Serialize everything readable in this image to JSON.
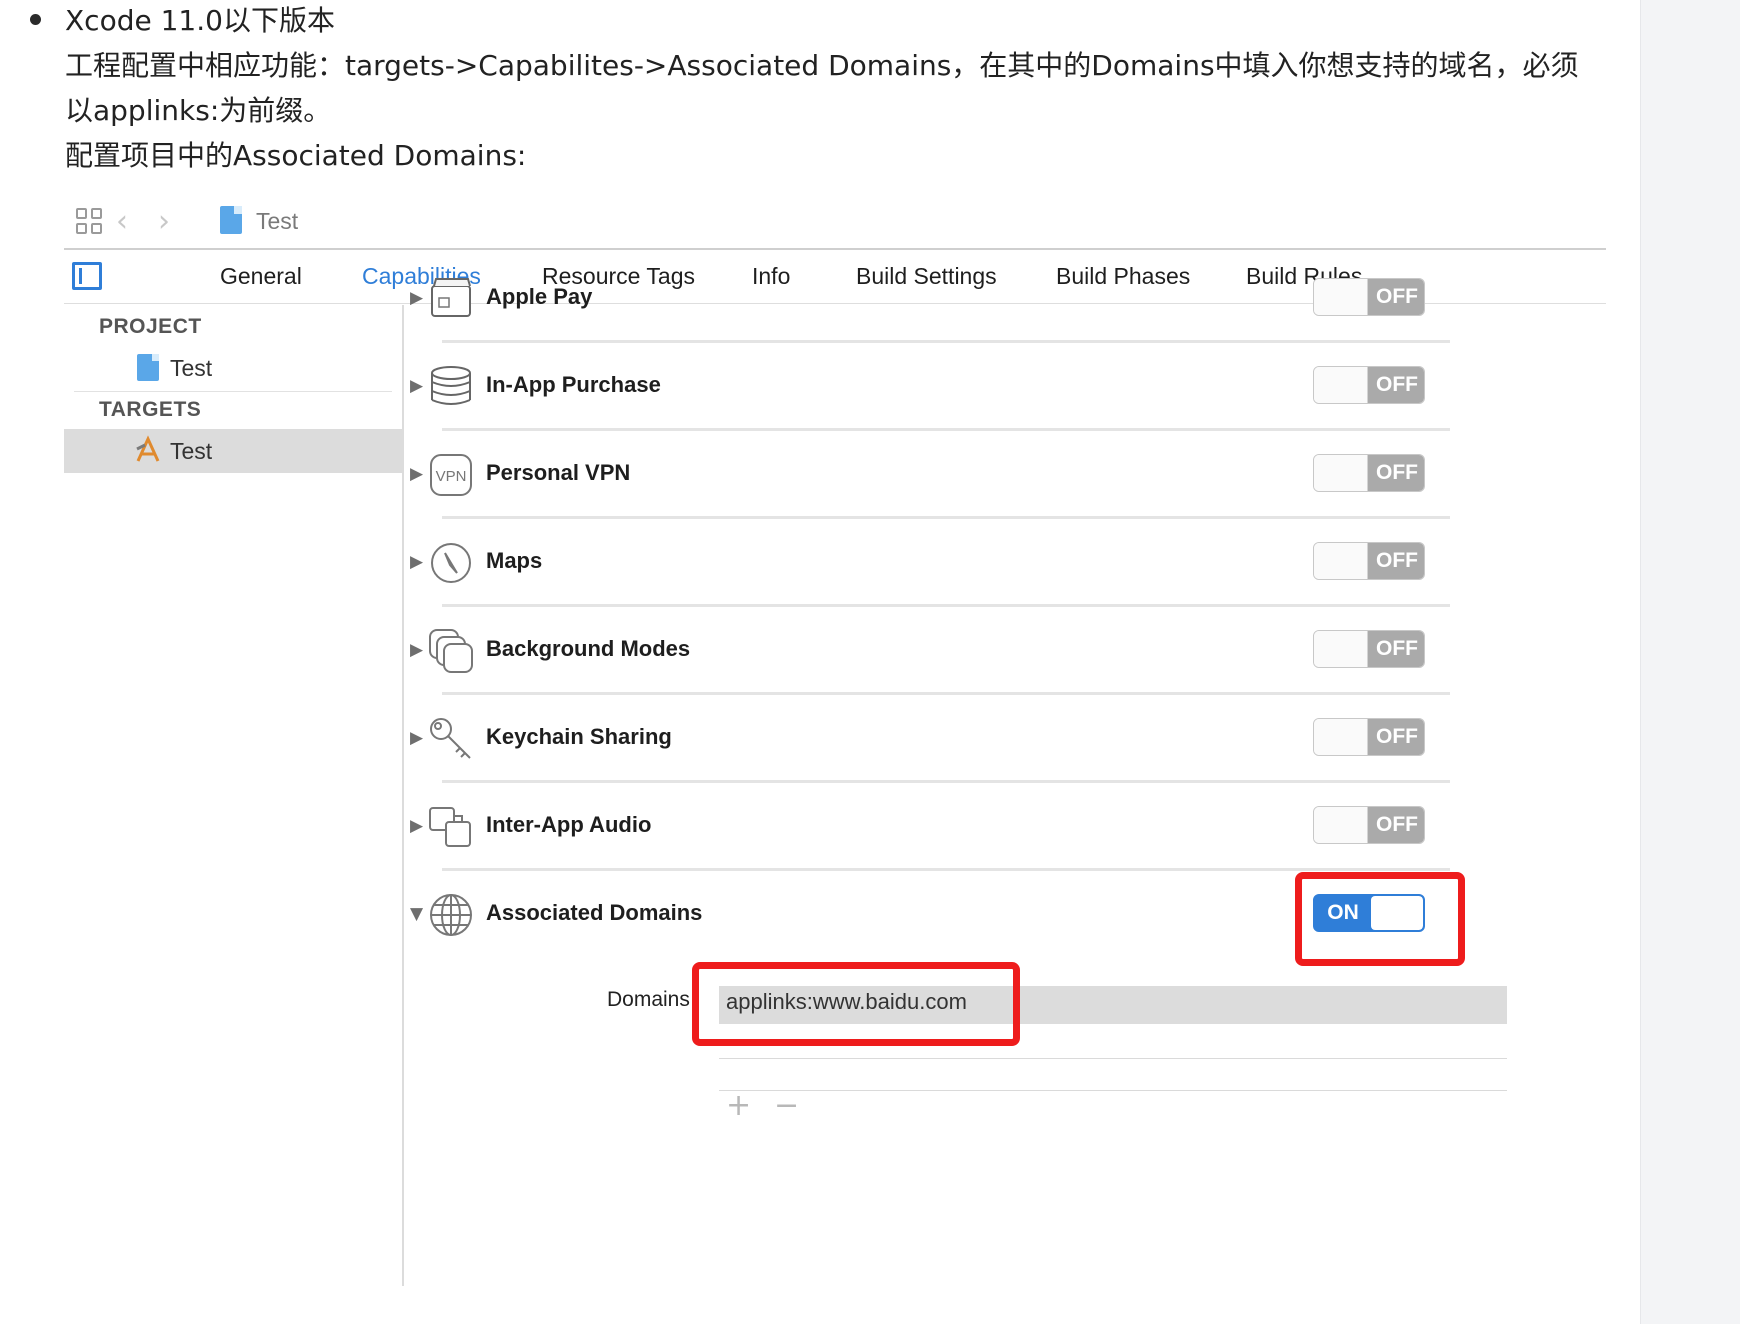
{
  "article": {
    "heading": "Xcode 11.0以下版本",
    "paragraph_line1": "工程配置中相应功能：targets->Capabilites->Associated Domains，在其中的Domains中填入你想支持的域名，必须",
    "paragraph_line2": "以applinks:为前缀。",
    "caption": "配置项目中的Associated Domains:"
  },
  "xcode": {
    "toolbar": {
      "title": "Test"
    },
    "tabs": [
      {
        "label": "General"
      },
      {
        "label": "Capabilities",
        "active": true
      },
      {
        "label": "Resource Tags"
      },
      {
        "label": "Info"
      },
      {
        "label": "Build Settings"
      },
      {
        "label": "Build Phases"
      },
      {
        "label": "Build Rules"
      }
    ],
    "navigator": {
      "project_header": "PROJECT",
      "project_item": "Test",
      "targets_header": "TARGETS",
      "target_item": "Test"
    },
    "capabilities": [
      {
        "label": "Apple Pay",
        "icon": "wallet-icon",
        "state": "OFF"
      },
      {
        "label": "In-App Purchase",
        "icon": "coins-icon",
        "state": "OFF"
      },
      {
        "label": "Personal VPN",
        "icon": "vpn-icon",
        "icon_text": "VPN",
        "state": "OFF"
      },
      {
        "label": "Maps",
        "icon": "compass-icon",
        "state": "OFF"
      },
      {
        "label": "Background Modes",
        "icon": "layers-icon",
        "state": "OFF"
      },
      {
        "label": "Keychain Sharing",
        "icon": "key-icon",
        "state": "OFF"
      },
      {
        "label": "Inter-App Audio",
        "icon": "audio-icon",
        "state": "OFF"
      },
      {
        "label": "Associated Domains",
        "icon": "globe-icon",
        "state": "ON",
        "expanded": true
      }
    ],
    "associated_domains": {
      "label": "Domains",
      "value": "applinks:www.baidu.com",
      "add": "+",
      "remove": "−"
    },
    "colors": {
      "accent": "#2f7ed8",
      "highlight": "#ee1c1c",
      "toggle_off": "#aaaaaa"
    }
  }
}
